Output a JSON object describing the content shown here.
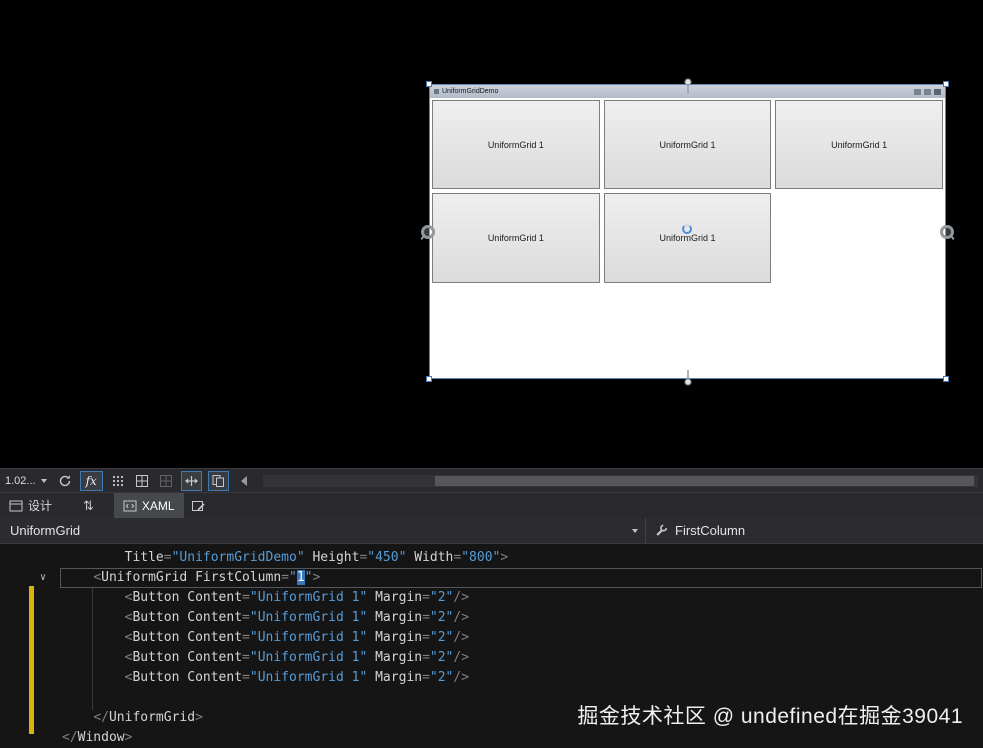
{
  "designer": {
    "window_title": "UniformGridDemo",
    "cells": [
      [
        "UniformGrid 1",
        "UniformGrid 1",
        "UniformGrid 1"
      ],
      [
        "UniformGrid 1",
        "UniformGrid 1",
        null
      ],
      [
        null,
        null,
        null
      ]
    ]
  },
  "toolbar": {
    "zoom_value": "1.02...",
    "fx_label": "fx"
  },
  "tabs": {
    "design": "设计",
    "xaml": "XAML"
  },
  "navbar": {
    "element": "UniformGrid",
    "member": "FirstColumn"
  },
  "glyphs": {
    "swap_arrows": "⇅",
    "fold_collapse": "∨"
  },
  "editor": {
    "lines": [
      {
        "current": false,
        "tokens": [
          [
            "w",
            "        "
          ],
          [
            "n",
            "Title"
          ],
          [
            "d",
            "="
          ],
          [
            "v",
            "\"UniformGridDemo\""
          ],
          [
            "w",
            " "
          ],
          [
            "n",
            "Height"
          ],
          [
            "d",
            "="
          ],
          [
            "v",
            "\"450\""
          ],
          [
            "w",
            " "
          ],
          [
            "n",
            "Width"
          ],
          [
            "d",
            "="
          ],
          [
            "v",
            "\"800\""
          ],
          [
            "d",
            ">"
          ]
        ]
      },
      {
        "current": true,
        "tokens": [
          [
            "w",
            "    "
          ],
          [
            "d",
            "<"
          ],
          [
            "n",
            "UniformGrid"
          ],
          [
            "w",
            " "
          ],
          [
            "n",
            "FirstColumn"
          ],
          [
            "d",
            "="
          ],
          [
            "v",
            "\""
          ],
          [
            "s",
            "1"
          ],
          [
            "v",
            "\""
          ],
          [
            "d",
            ">"
          ]
        ]
      },
      {
        "current": false,
        "tokens": [
          [
            "w",
            "        "
          ],
          [
            "d",
            "<"
          ],
          [
            "n",
            "Button"
          ],
          [
            "w",
            " "
          ],
          [
            "n",
            "Content"
          ],
          [
            "d",
            "="
          ],
          [
            "v",
            "\"UniformGrid 1\""
          ],
          [
            "w",
            " "
          ],
          [
            "n",
            "Margin"
          ],
          [
            "d",
            "="
          ],
          [
            "v",
            "\"2\""
          ],
          [
            "d",
            "/>"
          ]
        ]
      },
      {
        "current": false,
        "tokens": [
          [
            "w",
            "        "
          ],
          [
            "d",
            "<"
          ],
          [
            "n",
            "Button"
          ],
          [
            "w",
            " "
          ],
          [
            "n",
            "Content"
          ],
          [
            "d",
            "="
          ],
          [
            "v",
            "\"UniformGrid 1\""
          ],
          [
            "w",
            " "
          ],
          [
            "n",
            "Margin"
          ],
          [
            "d",
            "="
          ],
          [
            "v",
            "\"2\""
          ],
          [
            "d",
            "/>"
          ]
        ]
      },
      {
        "current": false,
        "tokens": [
          [
            "w",
            "        "
          ],
          [
            "d",
            "<"
          ],
          [
            "n",
            "Button"
          ],
          [
            "w",
            " "
          ],
          [
            "n",
            "Content"
          ],
          [
            "d",
            "="
          ],
          [
            "v",
            "\"UniformGrid 1\""
          ],
          [
            "w",
            " "
          ],
          [
            "n",
            "Margin"
          ],
          [
            "d",
            "="
          ],
          [
            "v",
            "\"2\""
          ],
          [
            "d",
            "/>"
          ]
        ]
      },
      {
        "current": false,
        "tokens": [
          [
            "w",
            "        "
          ],
          [
            "d",
            "<"
          ],
          [
            "n",
            "Button"
          ],
          [
            "w",
            " "
          ],
          [
            "n",
            "Content"
          ],
          [
            "d",
            "="
          ],
          [
            "v",
            "\"UniformGrid 1\""
          ],
          [
            "w",
            " "
          ],
          [
            "n",
            "Margin"
          ],
          [
            "d",
            "="
          ],
          [
            "v",
            "\"2\""
          ],
          [
            "d",
            "/>"
          ]
        ]
      },
      {
        "current": false,
        "tokens": [
          [
            "w",
            "        "
          ],
          [
            "d",
            "<"
          ],
          [
            "n",
            "Button"
          ],
          [
            "w",
            " "
          ],
          [
            "n",
            "Content"
          ],
          [
            "d",
            "="
          ],
          [
            "v",
            "\"UniformGrid 1\""
          ],
          [
            "w",
            " "
          ],
          [
            "n",
            "Margin"
          ],
          [
            "d",
            "="
          ],
          [
            "v",
            "\"2\""
          ],
          [
            "d",
            "/>"
          ]
        ]
      },
      {
        "current": false,
        "tokens": []
      },
      {
        "current": false,
        "tokens": [
          [
            "w",
            "    "
          ],
          [
            "d",
            "</"
          ],
          [
            "n",
            "UniformGrid"
          ],
          [
            "d",
            ">"
          ]
        ]
      },
      {
        "current": false,
        "tokens": [
          [
            "d",
            "</"
          ],
          [
            "n",
            "Window"
          ],
          [
            "d",
            ">"
          ]
        ]
      }
    ]
  },
  "watermark": "掘金技术社区 @ undefined在掘金39041",
  "colors": {
    "accent_toggle_border": "#3d7bb5",
    "xaml_value_blue": "#569cd6",
    "modified_yellow": "#d9b40d",
    "selection_blue": "#3677be"
  }
}
